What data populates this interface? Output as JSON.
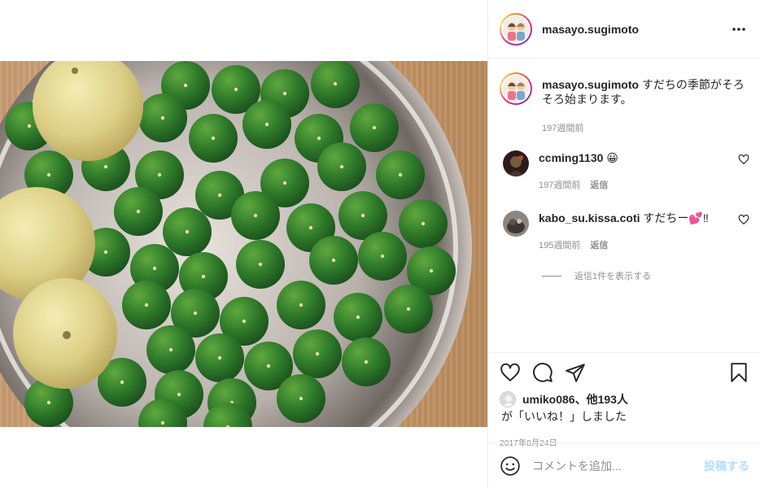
{
  "post": {
    "username": "masayo.sugimoto",
    "caption": "すだちの季節がそろそろ始まります。",
    "caption_time": "197週間前",
    "likes_user": "umiko086",
    "likes_rest": "、他193人",
    "likes_suffix": "が「いいね！」しました",
    "date": "2017年8月24日"
  },
  "comments": [
    {
      "username": "ccming1130",
      "text": "😀",
      "time": "197週間前",
      "reply": "返信"
    },
    {
      "username": "kabo_su.kissa.coti",
      "text": "すだちー💕‼",
      "time": "195週間前",
      "reply": "返信",
      "view_replies": "返信1件を表示する"
    }
  ],
  "add_comment": {
    "placeholder": "コメントを追加...",
    "post_label": "投稿する"
  },
  "icons": [
    "more-icon",
    "heart-icon",
    "comment-icon",
    "share-icon",
    "bookmark-icon",
    "emoji-icon"
  ],
  "colors": {
    "accent": "#b2dffc",
    "muted": "#8e8e8e",
    "text": "#262626",
    "border": "#efefef"
  }
}
